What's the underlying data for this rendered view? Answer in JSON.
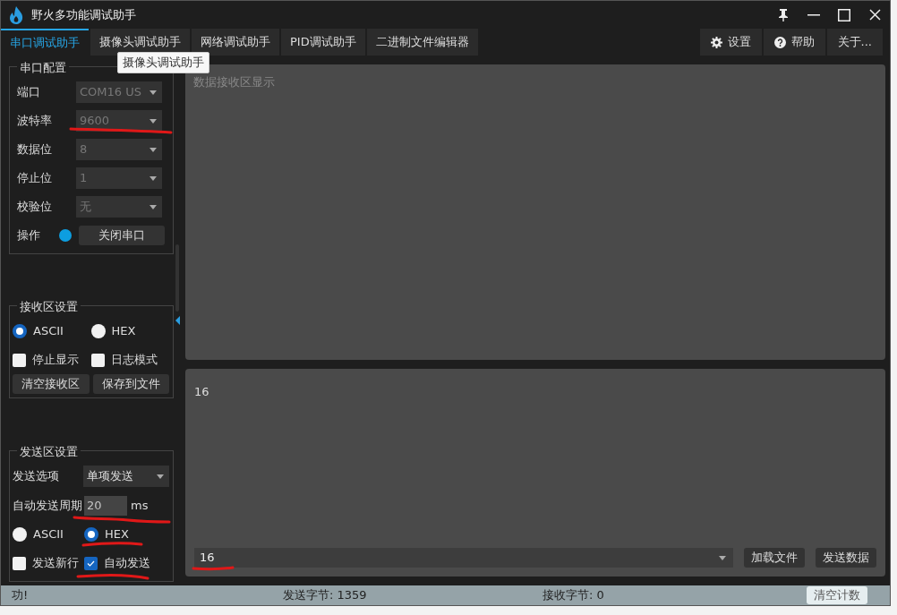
{
  "window": {
    "title": "野火多功能调试助手"
  },
  "tabs": [
    {
      "label": "串口调试助手",
      "selected": true
    },
    {
      "label": "摄像头调试助手",
      "selected": false
    },
    {
      "label": "网络调试助手",
      "selected": false
    },
    {
      "label": "PID调试助手",
      "selected": false
    },
    {
      "label": "二进制文件编辑器",
      "selected": false
    }
  ],
  "menu_buttons": [
    {
      "kind": "settings",
      "label": "设置"
    },
    {
      "kind": "help",
      "label": "帮助"
    },
    {
      "kind": "about",
      "label": "关于..."
    }
  ],
  "tooltip": {
    "text": "摄像头调试助手"
  },
  "serial_config": {
    "title": "串口配置",
    "fields": [
      {
        "label": "端口",
        "value": "COM16 US",
        "disabled": true
      },
      {
        "label": "波特率",
        "value": "9600",
        "disabled": true
      },
      {
        "label": "数据位",
        "value": "8",
        "disabled": true
      },
      {
        "label": "停止位",
        "value": "1",
        "disabled": true
      },
      {
        "label": "校验位",
        "value": "无",
        "disabled": true
      }
    ],
    "operation": {
      "label": "操作",
      "connected": true,
      "button": "关闭串口"
    }
  },
  "receive_settings": {
    "title": "接收区设置",
    "encodings": [
      {
        "label": "ASCII",
        "selected": true
      },
      {
        "label": "HEX",
        "selected": false
      }
    ],
    "options": [
      {
        "label": "停止显示",
        "checked": false
      },
      {
        "label": "日志模式",
        "checked": false
      }
    ],
    "buttons": [
      "清空接收区",
      "保存到文件"
    ]
  },
  "send_settings": {
    "title": "发送区设置",
    "send_option": {
      "label": "发送选项",
      "value": "单项发送"
    },
    "auto_period": {
      "label": "自动发送周期",
      "value": "20",
      "unit": "ms"
    },
    "encodings": [
      {
        "label": "ASCII",
        "selected": false
      },
      {
        "label": "HEX",
        "selected": true
      }
    ],
    "options": [
      {
        "label": "发送新行",
        "checked": false
      },
      {
        "label": "自动发送",
        "checked": true
      }
    ]
  },
  "receive_area": {
    "placeholder": "数据接收区显示"
  },
  "send_area": {
    "text": "16",
    "history_value": "16",
    "buttons": [
      "加载文件",
      "发送数据"
    ]
  },
  "status_bar": {
    "message": "功!",
    "sent": "发送字节: 1359",
    "received": "接收字节: 0",
    "button": "清空计数"
  }
}
